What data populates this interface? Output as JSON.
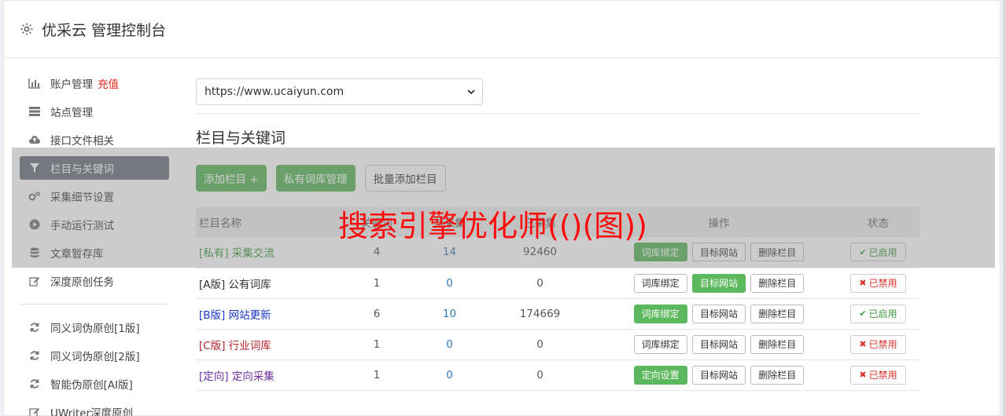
{
  "header": {
    "title": "优采云 管理控制台"
  },
  "sidebar": {
    "account_label": "账户管理",
    "account_recharge": "充值",
    "items": [
      {
        "label": "站点管理",
        "icon": "server-icon"
      },
      {
        "label": "接口文件相关",
        "icon": "cloud-upload-icon"
      },
      {
        "label": "栏目与关键词",
        "icon": "filter-icon"
      },
      {
        "label": "采集细节设置",
        "icon": "cogs-icon"
      },
      {
        "label": "手动运行测试",
        "icon": "play-circle-icon"
      },
      {
        "label": "文章暂存库",
        "icon": "database-icon"
      },
      {
        "label": "深度原创任务",
        "icon": "edit-icon"
      }
    ],
    "items2": [
      {
        "label": "同义词伪原创[1版]"
      },
      {
        "label": "同义词伪原创[2版]"
      },
      {
        "label": "智能伪原创[AI版]"
      },
      {
        "label": "UWriter深度原创"
      }
    ]
  },
  "main": {
    "site_select": "https://www.ucaiyun.com",
    "section_title": "栏目与关键词",
    "buttons": {
      "add": "添加栏目 +",
      "private": "私有词库管理",
      "batch": "批量添加栏目"
    },
    "table": {
      "headers": [
        "栏目名称",
        "关键词",
        "待采集",
        "已采集",
        "操作",
        "状态"
      ],
      "rows": [
        {
          "name": "[私有] 采集交流",
          "a": "4",
          "b": "14",
          "c": "92460",
          "op1": "词库绑定",
          "op2": "目标网站",
          "op3": "删除栏目",
          "status": "已启用"
        },
        {
          "name": "[A版] 公有词库",
          "a": "1",
          "b": "0",
          "c": "0",
          "op1": "词库绑定",
          "op2": "目标网站",
          "op3": "删除栏目",
          "status": "已禁用"
        },
        {
          "name": "[B版] 网站更新",
          "a": "6",
          "b": "10",
          "c": "174669",
          "op1": "词库绑定",
          "op2": "目标网站",
          "op3": "删除栏目",
          "status": "已启用"
        },
        {
          "name": "[C版] 行业词库",
          "a": "1",
          "b": "0",
          "c": "0",
          "op1": "词库绑定",
          "op2": "目标网站",
          "op3": "删除栏目",
          "status": "已禁用"
        },
        {
          "name": "[定向] 定向采集",
          "a": "1",
          "b": "0",
          "c": "0",
          "op1": "定向设置",
          "op2": "目标网站",
          "op3": "删除栏目",
          "status": "已禁用"
        }
      ]
    }
  },
  "overlay_text": "搜索引擎优化师(()(图))",
  "colors": {
    "green": "#5cb85c",
    "active_nav": "#6c757d",
    "red": "#e0241b"
  }
}
